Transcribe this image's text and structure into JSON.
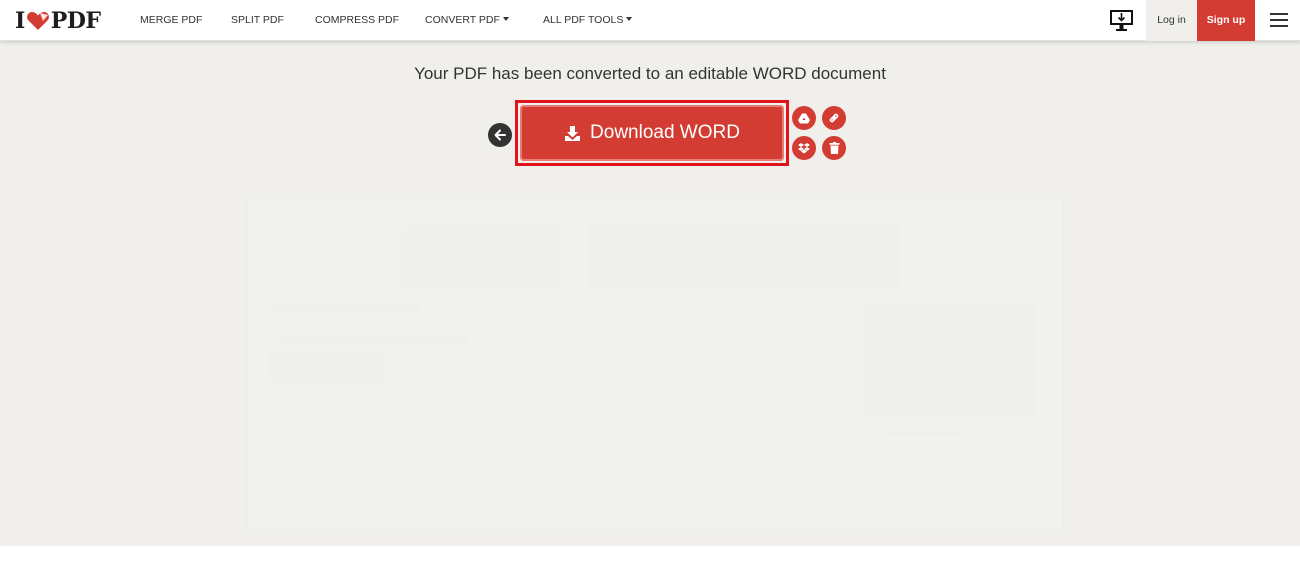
{
  "header": {
    "logo": {
      "left": "I",
      "right": "PDF",
      "heart_color": "#d33c32"
    },
    "nav": [
      {
        "label": "MERGE PDF",
        "dropdown": false
      },
      {
        "label": "SPLIT PDF",
        "dropdown": false
      },
      {
        "label": "COMPRESS PDF",
        "dropdown": false
      },
      {
        "label": "CONVERT PDF",
        "dropdown": true
      },
      {
        "label": "ALL PDF TOOLS",
        "dropdown": true
      }
    ],
    "desktop_icon": "desktop-download-icon",
    "login_label": "Log in",
    "signup_label": "Sign up",
    "menu_icon": "hamburger-menu-icon"
  },
  "main": {
    "title": "Your PDF has been converted to an editable WORD document",
    "download_label": "Download WORD",
    "back_icon": "arrow-left-icon",
    "actions": [
      {
        "name": "google-drive",
        "icon": "google-drive-icon"
      },
      {
        "name": "copy-link",
        "icon": "link-icon"
      },
      {
        "name": "dropbox",
        "icon": "dropbox-icon"
      },
      {
        "name": "delete",
        "icon": "trash-icon"
      }
    ]
  },
  "colors": {
    "brand_red": "#d33c32",
    "highlight_red": "#e0121c",
    "background": "#f0efec",
    "dark": "#333333"
  }
}
